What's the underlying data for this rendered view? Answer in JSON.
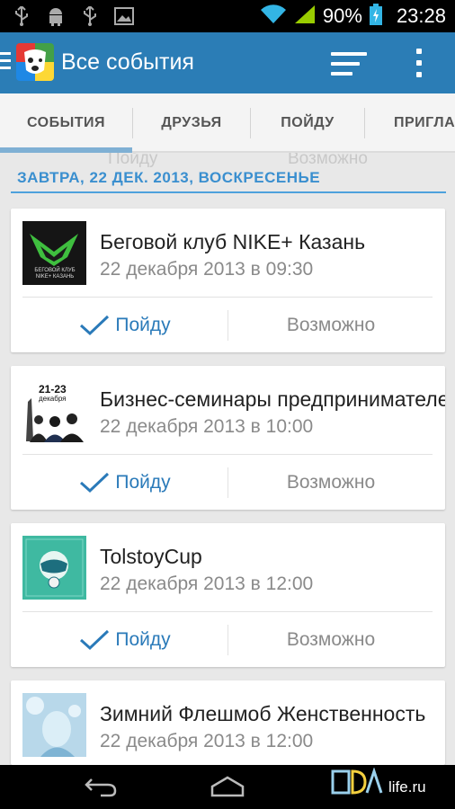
{
  "status_bar": {
    "icons": [
      "usb-icon",
      "android-debug-icon",
      "usb-icon",
      "image-icon"
    ],
    "battery_percent": "90%",
    "time": "23:28"
  },
  "action_bar": {
    "title": "Все события",
    "icons": [
      "menu-icon",
      "vk-logo",
      "sort-icon",
      "more-icon"
    ]
  },
  "tabs": [
    {
      "label": "СОБЫТИЯ",
      "selected": true
    },
    {
      "label": "ДРУЗЬЯ",
      "selected": false
    },
    {
      "label": "ПОЙДУ",
      "selected": false
    },
    {
      "label": "ПРИГЛАШЕНИЯ",
      "selected": false
    }
  ],
  "section": {
    "title": "ЗАВТРА, 22 ДЕК. 2013, ВОСКРЕСЕНЬЕ",
    "ghost_going": "Пойду",
    "ghost_maybe": "Возможно"
  },
  "events": [
    {
      "title": "Беговой клуб NIKE+ Казань",
      "date": "22 декабря 2013 в 09:30",
      "going": "Пойду",
      "maybe": "Возможно",
      "thumb_text": "БЕГОВОЙ КЛУБ NIKE+ КАЗАНЬ"
    },
    {
      "title": "Бизнес-семинары предпринимателей",
      "date": "22 декабря 2013 в 10:00",
      "going": "Пойду",
      "maybe": "Возможно",
      "thumb_top": "21-23",
      "thumb_sub": "декабря"
    },
    {
      "title": "TolstoyCup",
      "date": "22 декабря 2013 в 12:00",
      "going": "Пойду",
      "maybe": "Возможно"
    },
    {
      "title": "Зимний Флешмоб Женственность",
      "date": "22 декабря 2013 в 12:00",
      "going": "Пойду",
      "maybe": "Возможно"
    }
  ],
  "watermark": {
    "text": "life.ru"
  },
  "colors": {
    "action_bar": "#2b7db6",
    "accent": "#3a8fcf",
    "going": "#2a7ab9",
    "muted": "#8a8a8a",
    "background": "#e8e8e8"
  }
}
